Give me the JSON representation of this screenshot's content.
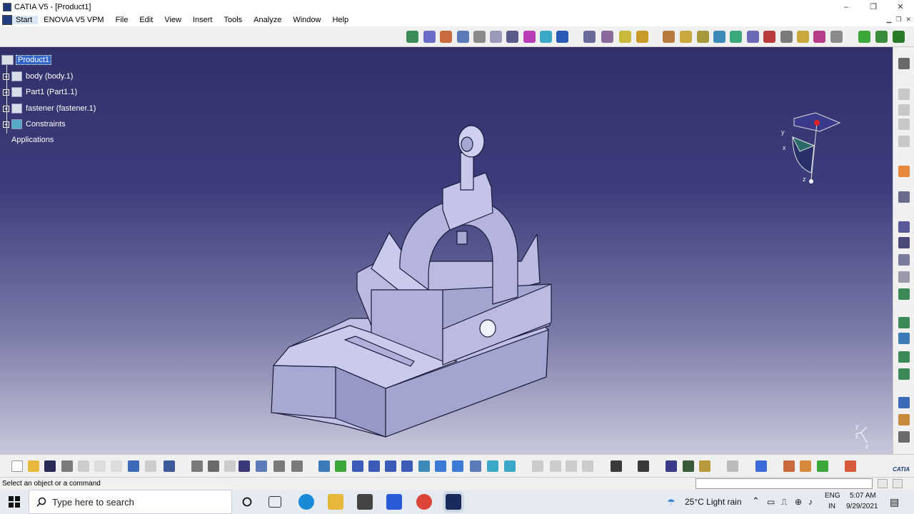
{
  "window": {
    "title": "CATIA V5 - [Product1]",
    "minimize": "–",
    "maximize": "❐",
    "close": "✕"
  },
  "menu": {
    "start": "Start",
    "items": [
      "ENOVIA V5 VPM",
      "File",
      "Edit",
      "View",
      "Insert",
      "Tools",
      "Analyze",
      "Window",
      "Help"
    ]
  },
  "tree": {
    "root": "Product1",
    "children": [
      "body (body.1)",
      "Part1 (Part1.1)",
      "fastener (fastener.1)",
      "Constraints"
    ],
    "applications": "Applications"
  },
  "compass": {
    "x": "x",
    "y": "y",
    "z": "z"
  },
  "triad": {
    "x": "x",
    "y": "y",
    "z": "z"
  },
  "status": {
    "message": "Select an object or a command"
  },
  "taskbar": {
    "search_placeholder": "Type here to search",
    "weather": "25°C  Light rain",
    "lang_top": "ENG",
    "lang_bottom": "IN",
    "time": "5:07 AM",
    "date": "9/29/2021"
  },
  "logo": "CATIA",
  "colors": {
    "viewport_top": "#32306a",
    "viewport_bottom": "#c8c8dc",
    "selection": "#3366cc",
    "part_face": "#b8b8e0"
  }
}
